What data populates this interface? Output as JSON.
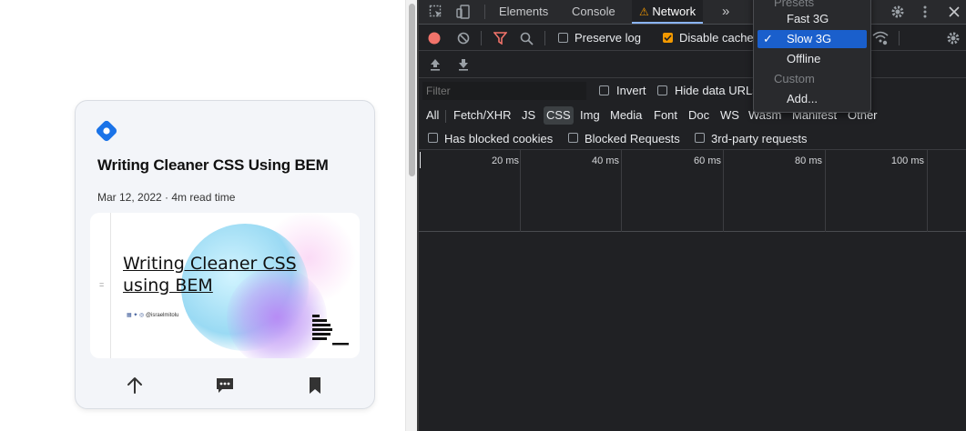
{
  "card": {
    "title": "Writing Cleaner CSS Using BEM",
    "meta": "Mar 12, 2022 · 4m read time",
    "image_title": "Writing Cleaner CSS using BEM",
    "image_handle": "@israelmitolu",
    "image_eq": "="
  },
  "devtools": {
    "tabs": {
      "elements": "Elements",
      "console": "Console",
      "network": "Network",
      "more": "»"
    },
    "toolbar": {
      "preserve_log": "Preserve log",
      "disable_cache": "Disable cache",
      "disable_cache_checked": true,
      "preserve_log_checked": false
    },
    "filter": {
      "placeholder": "Filter",
      "invert": "Invert",
      "hide_data_urls": "Hide data URLs"
    },
    "types": [
      "All",
      "Fetch/XHR",
      "JS",
      "CSS",
      "Img",
      "Media",
      "Font",
      "Doc",
      "WS",
      "Wasm",
      "Manifest",
      "Other"
    ],
    "active_type": "CSS",
    "blocked": {
      "has_blocked_cookies": "Has blocked cookies",
      "blocked_requests": "Blocked Requests",
      "third_party": "3rd-party requests"
    },
    "timeline_ticks": [
      "20 ms",
      "40 ms",
      "60 ms",
      "80 ms",
      "100 ms"
    ],
    "throttle_menu": {
      "presets_header": "Presets",
      "fast3g": "Fast 3G",
      "slow3g": "Slow 3G",
      "offline": "Offline",
      "custom_header": "Custom",
      "add": "Add...",
      "selected": "Slow 3G",
      "check": "✓"
    },
    "colors": {
      "accent": "#8ab4f8",
      "record": "#f2736a",
      "warning": "#f29900",
      "menu_selected": "#1a5fcc"
    }
  }
}
